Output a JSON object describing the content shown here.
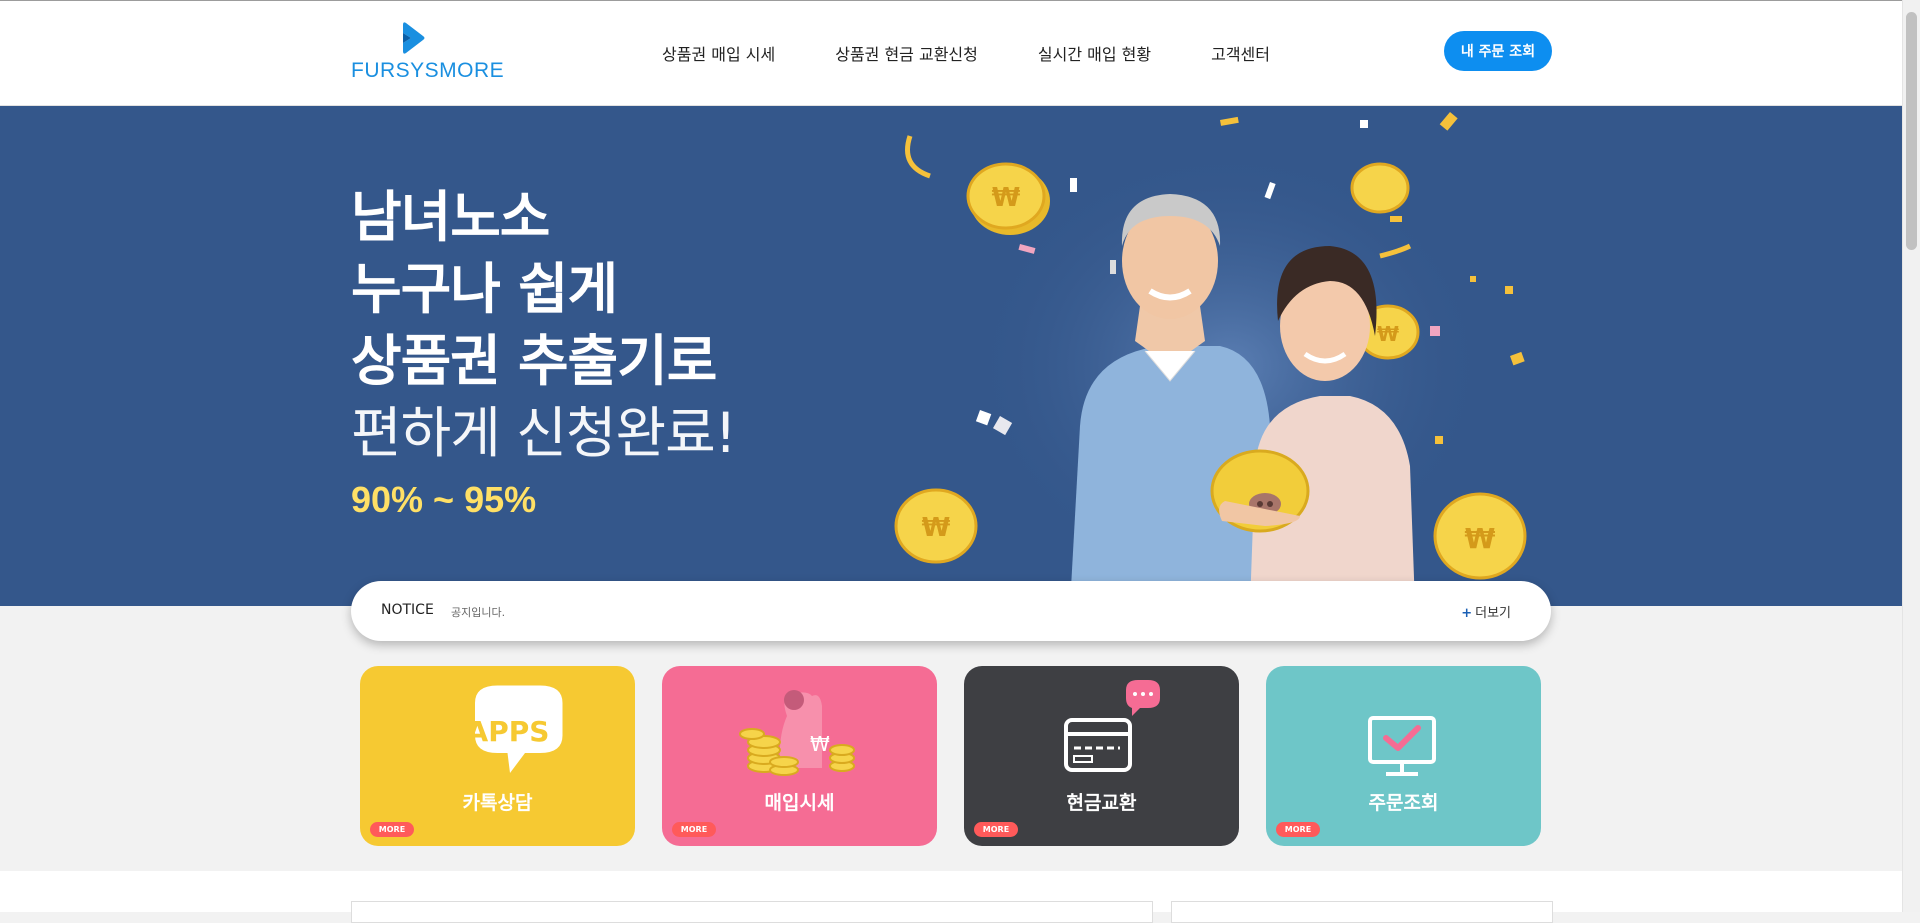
{
  "header": {
    "logo_text": "FURSYSMORE",
    "nav": [
      "상품권 매입 시세",
      "상품권 현금 교환신청",
      "실시간 매입 현황",
      "고객센터"
    ],
    "order_button": "내 주문 조회"
  },
  "hero": {
    "lines": [
      "남녀노소",
      "누구나 쉽게",
      "상품권 추출기로"
    ],
    "light_line": "편하게 신청완료!",
    "rate": "90% ~ 95%"
  },
  "notice": {
    "label": "NOTICE",
    "text": "공지입니다.",
    "more": "더보기"
  },
  "cards": [
    {
      "title": "카톡상담",
      "badge": "MORE",
      "icon_text": "APPS",
      "color": "#f6c932",
      "icon": "chat-bubble-icon"
    },
    {
      "title": "매입시세",
      "badge": "MORE",
      "color": "#f56c94",
      "icon": "coins-bag-icon"
    },
    {
      "title": "현금교환",
      "badge": "MORE",
      "color": "#3e3f43",
      "icon": "card-icon"
    },
    {
      "title": "주문조회",
      "badge": "MORE",
      "color": "#6ec6c8",
      "icon": "monitor-check-icon"
    }
  ],
  "colors": {
    "brand": "#1a8fe0",
    "hero_bg": "#34578b",
    "accent_yellow": "#ffe066",
    "button_blue": "#0d8ef0"
  }
}
